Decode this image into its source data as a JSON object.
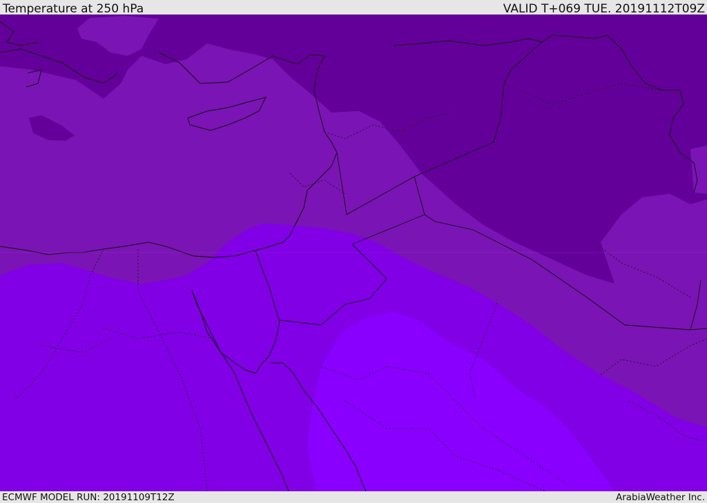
{
  "header": {
    "title": "Temperature at 250 hPa",
    "valid_time": "VALID T+069 TUE. 20191112T09Z"
  },
  "footer": {
    "model_run": "ECMWF MODEL RUN: 20191109T12Z",
    "credit": "ArabiaWeather Inc."
  },
  "map": {
    "field": "temperature",
    "level": "250 hPa",
    "region": "Eastern Mediterranean / Middle East",
    "colors": {
      "coldest_band": "#64009a",
      "cold_band": "#7a14b4",
      "mid_band": "#8000d8",
      "warm_band": "#8200f0",
      "warmest_band": "#8a00ff",
      "boundary_line": "#111111"
    }
  }
}
